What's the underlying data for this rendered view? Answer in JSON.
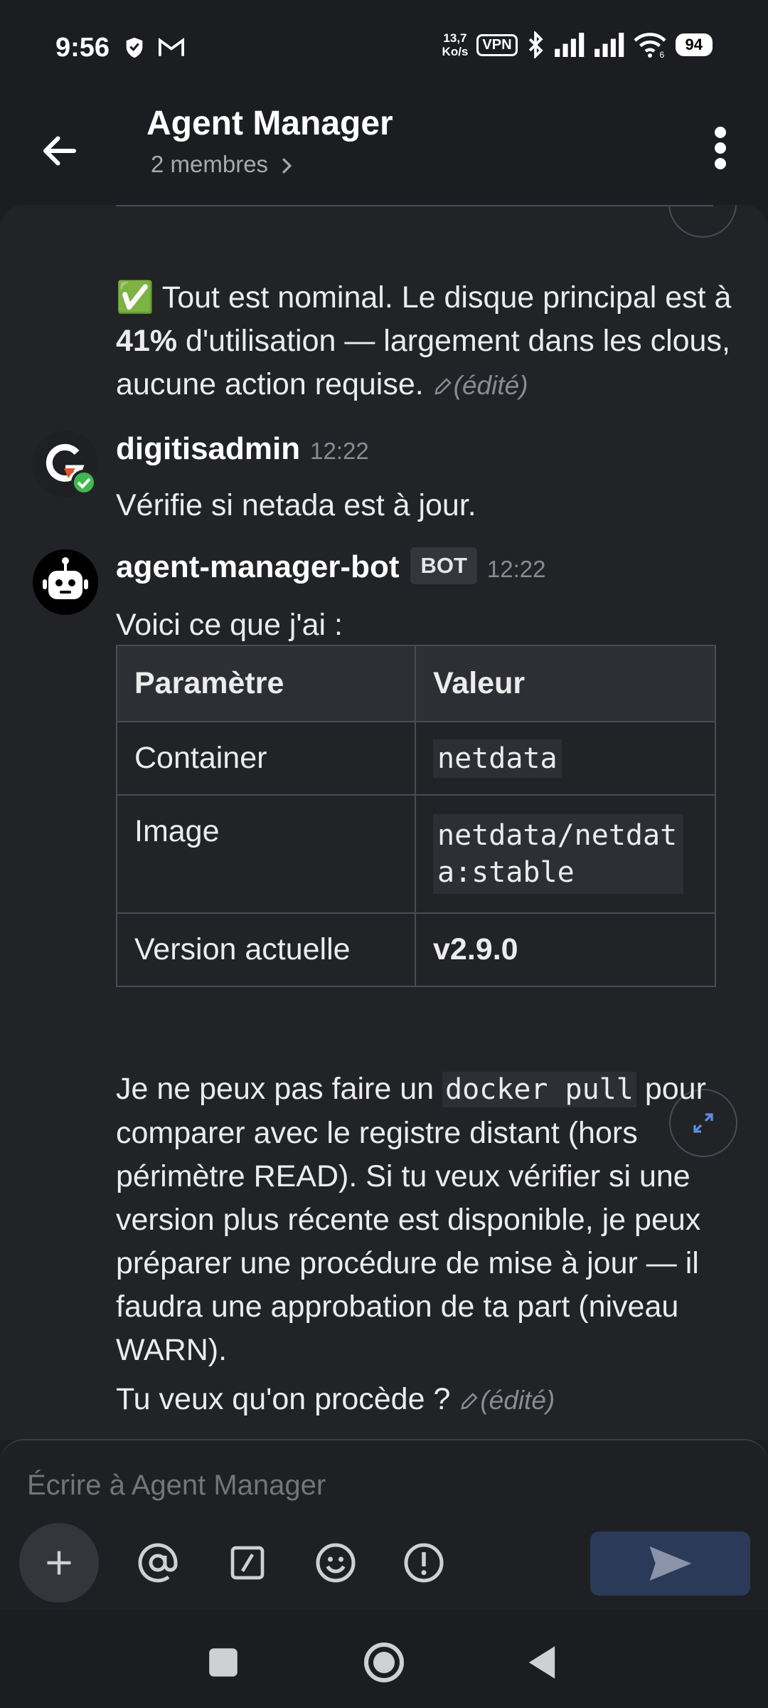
{
  "status_bar": {
    "time": "9:56",
    "speed_value": "13,7",
    "speed_unit": "Ko/s",
    "vpn": "VPN",
    "wifi_gen": "6",
    "battery": "94",
    "icons": [
      "shield-icon",
      "gmail-icon",
      "bluetooth-icon",
      "signal-icon",
      "signal-icon",
      "wifi-icon"
    ]
  },
  "header": {
    "title": "Agent Manager",
    "subtitle": "2 membres",
    "back_icon": "arrow-left-icon",
    "menu_icon": "kebab-menu-icon"
  },
  "messages": {
    "prev_bot": {
      "emoji": "✅",
      "before_bold": " Tout est nominal. Le disque principal est à ",
      "bold": "41%",
      "after_bold": " d'utilisation — largement dans les clous, aucune action requise.",
      "edited": "(édité)"
    },
    "user_msg": {
      "author": "digitisadmin",
      "time": "12:22",
      "text": "Vérifie si netada est à jour."
    },
    "bot_msg": {
      "author": "agent-manager-bot",
      "badge": "BOT",
      "time": "12:22",
      "intro": "Voici ce que j'ai :",
      "table": {
        "headers": [
          "Paramètre",
          "Valeur"
        ],
        "rows": [
          [
            "Container",
            "netdata"
          ],
          [
            "Image",
            "netdata/netdata:stable"
          ],
          [
            "Version actuelle",
            "v2.9.0"
          ]
        ]
      },
      "para1_before": "Je ne peux pas faire un ",
      "para1_code": "docker pull",
      "para1_after": " pour comparer avec le registre distant (hors périmètre READ). Si tu veux vérifier si une version plus récente est disponible, je peux préparer une procédure de mise à jour — il faudra une approbation de ta part (niveau WARN).",
      "para2": "Tu veux qu'on procède ?",
      "edited": "(édité)"
    }
  },
  "composer": {
    "placeholder": "Écrire à Agent Manager",
    "tools": [
      "plus-icon",
      "at-icon",
      "slash-command-icon",
      "emoji-icon",
      "alert-icon"
    ],
    "send_icon": "send-icon"
  },
  "nav": [
    "recents-icon",
    "home-icon",
    "back-triangle-icon"
  ],
  "colors": {
    "background": "#1b1d21",
    "chat_bg": "#222327",
    "accent_send": "#2c3a59",
    "check_green": "#3fb950"
  }
}
